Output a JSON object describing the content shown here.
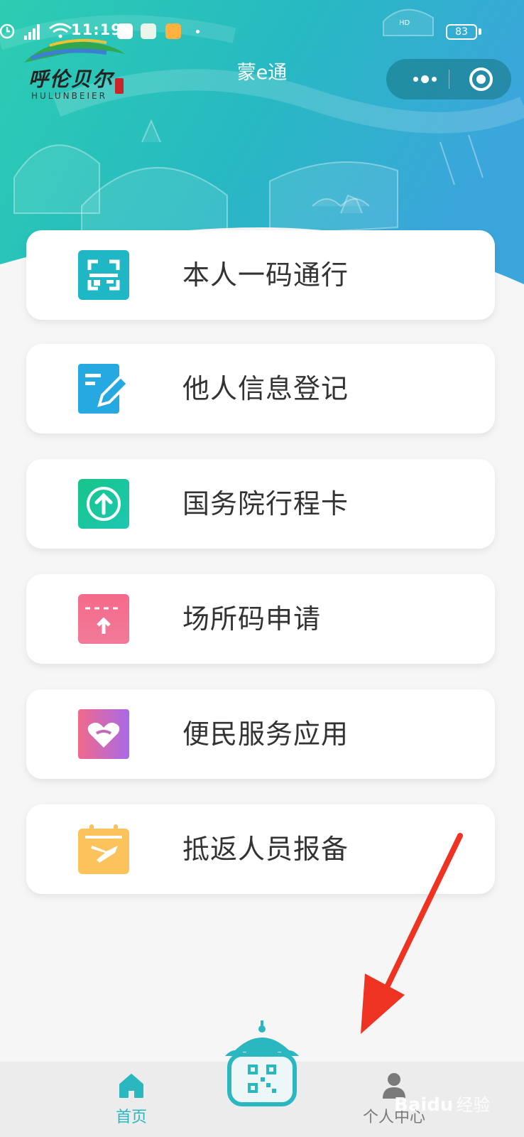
{
  "status_bar": {
    "time": "11:19",
    "network_label": "HD",
    "battery": "83"
  },
  "header": {
    "title": "蒙e通",
    "logo_text": "呼伦贝尔",
    "logo_subtext": "HULUNBEIER"
  },
  "menu": {
    "items": [
      {
        "label": "本人一码通行",
        "icon": "scan-code-icon",
        "color": "#1fb6c5"
      },
      {
        "label": "他人信息登记",
        "icon": "edit-form-icon",
        "color": "#25a9e0"
      },
      {
        "label": "国务院行程卡",
        "icon": "upload-arrow-icon",
        "color": "#18c59e"
      },
      {
        "label": "场所码申请",
        "icon": "ticket-upload-icon",
        "color": "#f46a8a"
      },
      {
        "label": "便民服务应用",
        "icon": "heart-hands-icon",
        "color": "#c067d8"
      },
      {
        "label": "抵返人员报备",
        "icon": "calendar-plane-icon",
        "color": "#fcc25b"
      }
    ]
  },
  "tabbar": {
    "home_label": "首页",
    "me_label": "个人中心"
  },
  "watermark": {
    "brand": "Baidu",
    "suffix": "经验"
  },
  "colors": {
    "accent": "#2bb7bf",
    "header_start": "#2cc8b4",
    "header_end": "#3aa7d8"
  }
}
